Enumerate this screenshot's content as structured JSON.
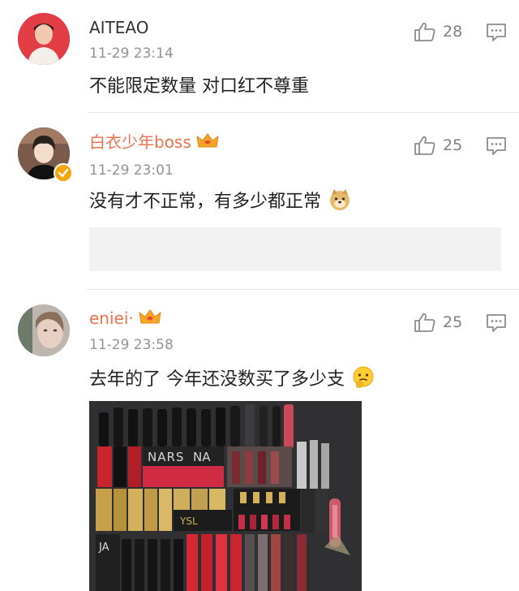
{
  "comments": [
    {
      "username": "AITEAO",
      "timestamp": "11-29 23:14",
      "like_count": "28",
      "text": "不能限定数量 对口红不尊重"
    },
    {
      "username": "白衣少年boss",
      "timestamp": "11-29 23:01",
      "like_count": "25",
      "text": "没有才不正常，有多少都正常"
    },
    {
      "username": "eniei·",
      "timestamp": "11-29 23:58",
      "like_count": "25",
      "text": "去年的了 今年还没数买了多少支"
    }
  ],
  "photo_brands": {
    "nars": "NARS",
    "nars2": "NA",
    "ysl": "YSL",
    "ja": "JA"
  },
  "colors": {
    "vip_username": "#eb7350",
    "meta": "#939393",
    "icon": "#8c8c8c",
    "verified_badge": "#f7a60c"
  }
}
